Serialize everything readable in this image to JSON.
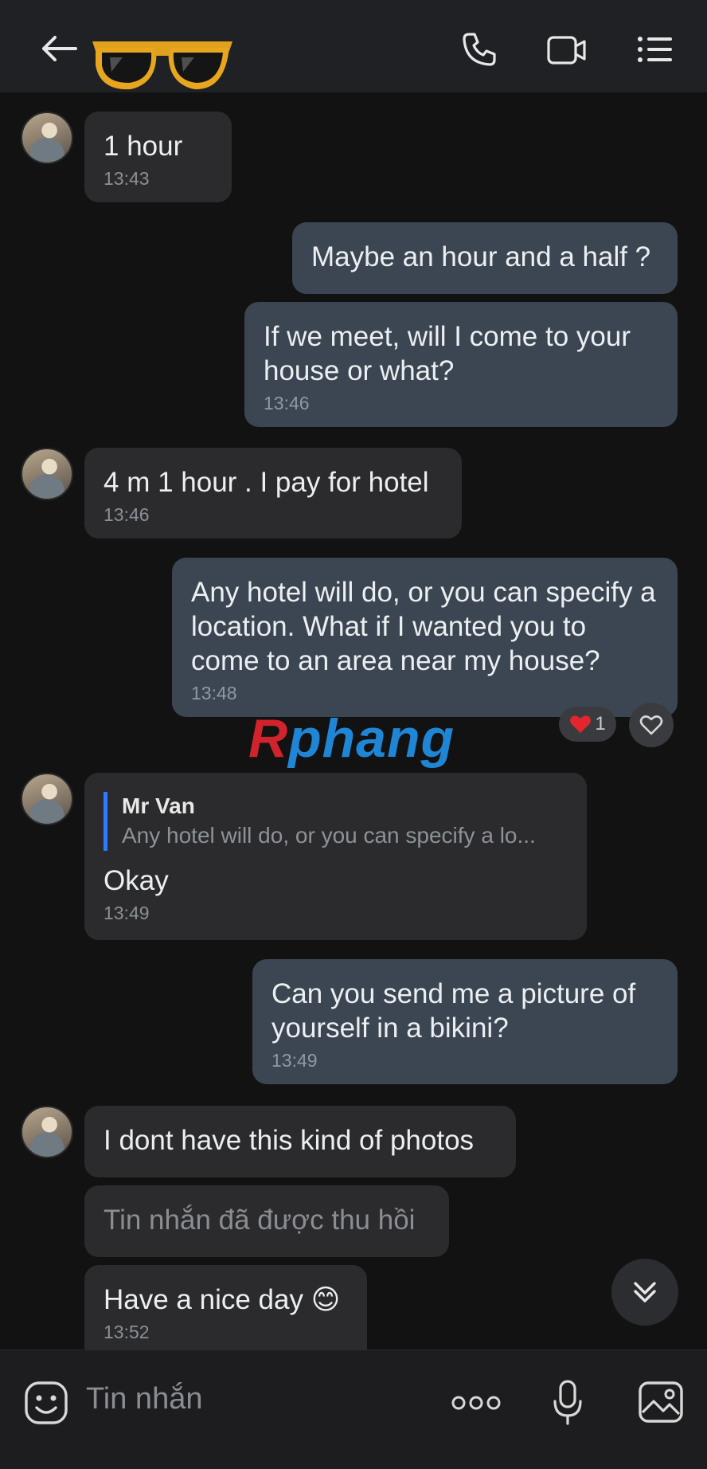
{
  "header": {
    "back_icon": "arrow-left-icon",
    "sticker": "sunglasses-sticker",
    "call_icon": "phone-icon",
    "video_icon": "video-camera-icon",
    "menu_icon": "list-menu-icon"
  },
  "messages": [
    {
      "dir": "in",
      "text": "1 hour",
      "time": "13:43"
    },
    {
      "dir": "out",
      "text": "Maybe an hour and a half ?",
      "time": ""
    },
    {
      "dir": "out",
      "text": "If we meet, will I come to your house or what?",
      "time": "13:46"
    },
    {
      "dir": "in",
      "text": "4 m 1 hour . I pay for hotel",
      "time": "13:46"
    },
    {
      "dir": "out",
      "text": "Any hotel will do, or you can specify a location. What if I wanted you to come to an area near my house?",
      "time": "13:48",
      "reaction_count": "1"
    },
    {
      "dir": "in",
      "quote_name": "Mr Van",
      "quote_text": "Any hotel will do, or you can specify a lo...",
      "text": "Okay",
      "time": "13:49"
    },
    {
      "dir": "out",
      "text": "Can you send me a picture of yourself in a bikini?",
      "time": "13:49"
    },
    {
      "dir": "in",
      "text": "I dont have this kind of photos",
      "time": ""
    },
    {
      "dir": "in",
      "text": "Tin nhắn đã được thu hồi",
      "time": "",
      "recalled": true
    },
    {
      "dir": "in",
      "text": "Have a nice day 😊",
      "time": "13:52"
    }
  ],
  "watermark": {
    "part1": "R",
    "part2": "phang"
  },
  "composer": {
    "placeholder": "Tin nhắn",
    "emoji_icon": "emoji-sticker-icon",
    "more_icon": "more-dots-icon",
    "mic_icon": "microphone-icon",
    "image_icon": "image-icon"
  },
  "colors": {
    "background": "#121212",
    "incoming_bubble": "#2b2b2d",
    "outgoing_bubble": "#3b4652",
    "quote_bar": "#2d7bff"
  }
}
